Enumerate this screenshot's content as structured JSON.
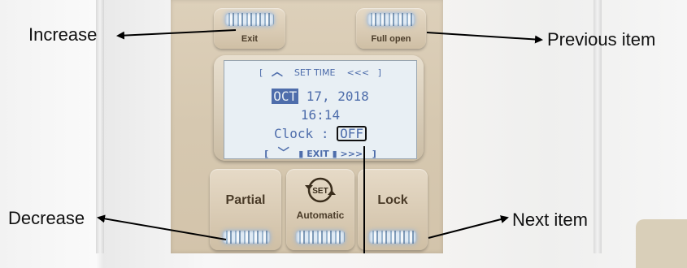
{
  "annotations": {
    "increase": "Increase",
    "previous_item": "Previous item",
    "decrease": "Decrease",
    "next_item": "Next item"
  },
  "keys": {
    "exit": "Exit",
    "full_open": "Full open",
    "partial": "Partial",
    "automatic": "Automatic",
    "set_icon": "SET",
    "lock": "Lock"
  },
  "screen": {
    "top_left_bracket": "[",
    "up_arrow": "︿",
    "menu_title": "SET TIME",
    "back_chevrons": "<<<",
    "top_right_bracket": "]",
    "month": "OCT",
    "date_rest": " 17, 2018",
    "time": "16:14",
    "clock_label": "Clock : ",
    "clock_value": "OFF",
    "down_arrow": "﹀",
    "exit_label": "EXIT",
    "forward_chevrons": ">>>"
  },
  "colors": {
    "led": "#a9c2dc",
    "panel": "#d8cab2",
    "lcd_text": "#4e6dab",
    "lcd_background": "#e8eff4"
  }
}
